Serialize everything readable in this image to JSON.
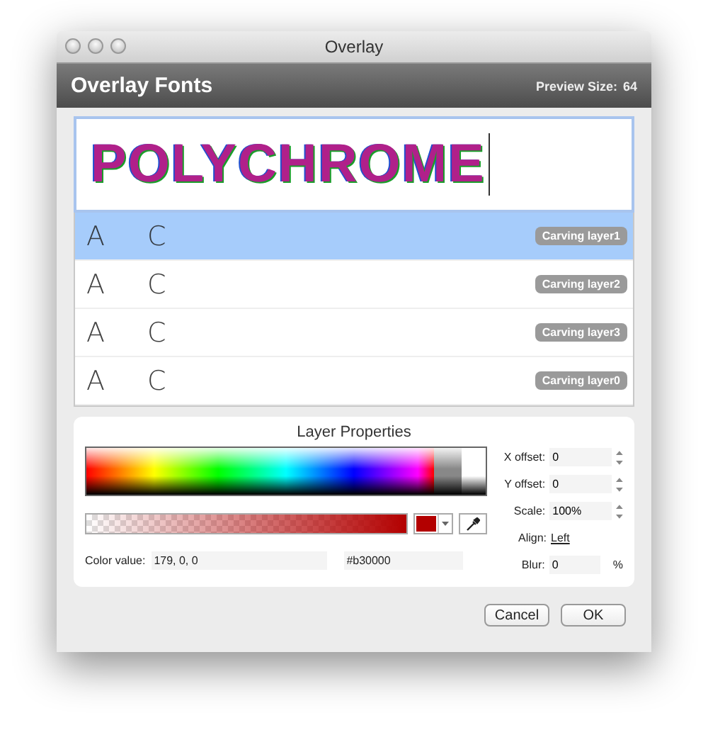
{
  "window": {
    "title": "Overlay"
  },
  "header": {
    "title": "Overlay Fonts",
    "preview_size_label": "Preview Size:",
    "preview_size": "64"
  },
  "preview": {
    "text": "POLYCHROME"
  },
  "layers": [
    {
      "sample": "A C",
      "name": "Carving layer1",
      "selected": true
    },
    {
      "sample": "A C",
      "name": "Carving layer2",
      "selected": false
    },
    {
      "sample": "A C",
      "name": "Carving layer3",
      "selected": false
    },
    {
      "sample": "A C",
      "name": "Carving layer0",
      "selected": false
    }
  ],
  "properties": {
    "title": "Layer Properties",
    "color_value_label": "Color value:",
    "color_value": "179, 0, 0",
    "hex": "#b30000",
    "fields": [
      {
        "kind": "stepper",
        "label": "X offset:",
        "value": "0"
      },
      {
        "kind": "stepper",
        "label": "Y offset:",
        "value": "0"
      },
      {
        "kind": "stepper",
        "label": "Scale:",
        "value": "100%"
      },
      {
        "kind": "link",
        "label": "Align:",
        "value": "Left"
      },
      {
        "kind": "unit",
        "label": "Blur:",
        "value": "0",
        "unit": "%"
      }
    ]
  },
  "buttons": [
    "Cancel",
    "OK"
  ]
}
